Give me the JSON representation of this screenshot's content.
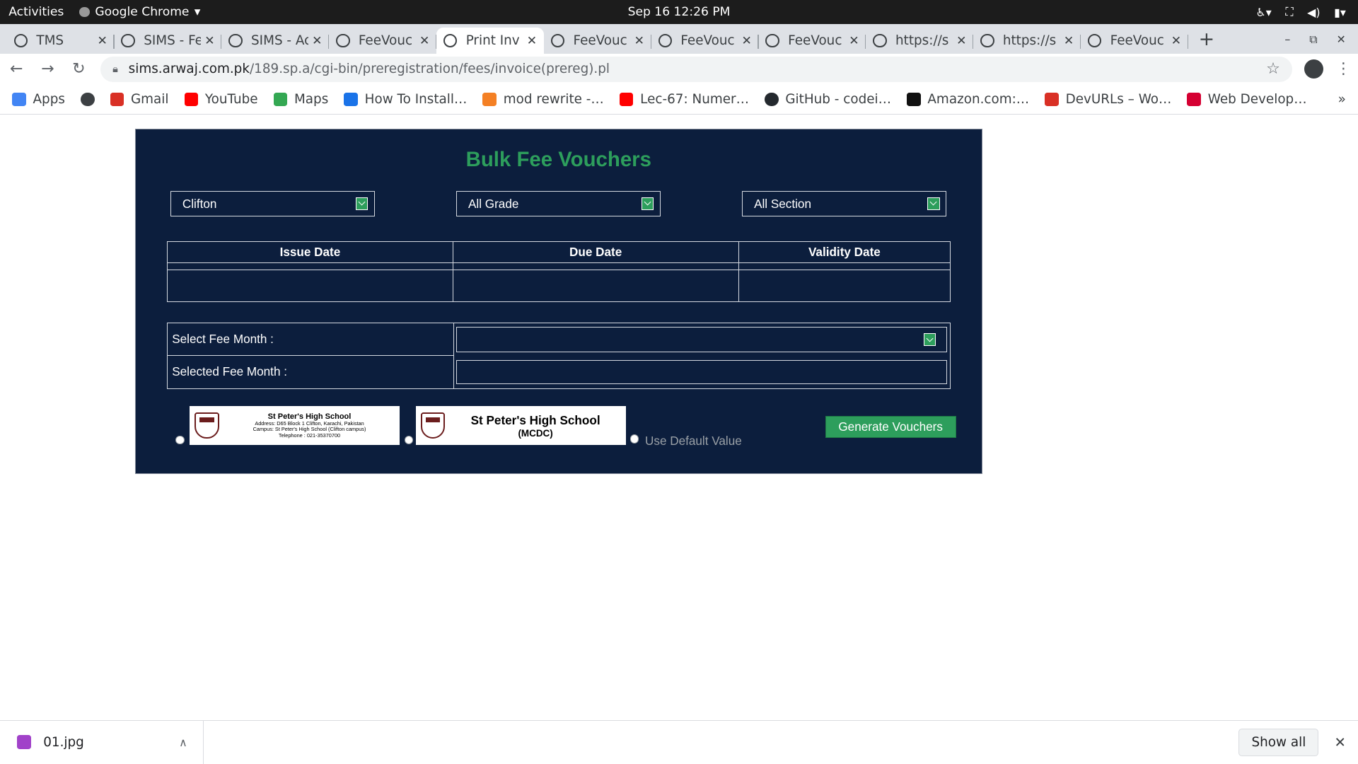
{
  "system": {
    "activities": "Activities",
    "app_name": "Google Chrome",
    "clock": "Sep 16  12:26 PM"
  },
  "tabs": [
    {
      "title": "TMS",
      "active": false
    },
    {
      "title": "SIMS - Fe",
      "active": false
    },
    {
      "title": "SIMS - Ac",
      "active": false
    },
    {
      "title": "FeeVouc",
      "active": false
    },
    {
      "title": "Print Inv",
      "active": true
    },
    {
      "title": "FeeVouc",
      "active": false
    },
    {
      "title": "FeeVouc",
      "active": false
    },
    {
      "title": "FeeVouc",
      "active": false
    },
    {
      "title": "https://s",
      "active": false
    },
    {
      "title": "https://s",
      "active": false
    },
    {
      "title": "FeeVouc",
      "active": false
    }
  ],
  "address": {
    "host": "sims.arwaj.com.pk",
    "path": "/189.sp.a/cgi-bin/preregistration/fees/invoice(prereg).pl"
  },
  "bookmarks": [
    {
      "label": "Apps",
      "icon": "apps-grid-icon",
      "color": "#4285f4"
    },
    {
      "label": "",
      "icon": "globe-icon",
      "color": "#3c4043"
    },
    {
      "label": "Gmail",
      "icon": "gmail-icon",
      "color": "#d93025"
    },
    {
      "label": "YouTube",
      "icon": "youtube-icon",
      "color": "#ff0000"
    },
    {
      "label": "Maps",
      "icon": "maps-pin-icon",
      "color": "#34a853"
    },
    {
      "label": "How To Install…",
      "icon": "refresh-blue-icon",
      "color": "#1a73e8"
    },
    {
      "label": "mod rewrite -…",
      "icon": "stackoverflow-icon",
      "color": "#f48024"
    },
    {
      "label": "Lec-67: Numer…",
      "icon": "youtube-icon",
      "color": "#ff0000"
    },
    {
      "label": "GitHub - codei…",
      "icon": "github-icon",
      "color": "#24292e"
    },
    {
      "label": "Amazon.com:…",
      "icon": "amazon-icon",
      "color": "#111111"
    },
    {
      "label": "DevURLs – Wo…",
      "icon": "devurls-icon",
      "color": "#d93025"
    },
    {
      "label": "Web Develop…",
      "icon": "web-develop-icon",
      "color": "#d50032"
    }
  ],
  "bookmarks_more": "»",
  "form": {
    "title": "Bulk Fee Vouchers",
    "campus": "Clifton",
    "grade": "All Grade",
    "section": "All Section",
    "date_headers": [
      "Issue Date",
      "Due Date",
      "Validity Date"
    ],
    "select_fee_month_label": "Select Fee Month :",
    "selected_fee_month_label": "Selected Fee Month :",
    "header1": {
      "name": "St Peter's High School",
      "address": "Address: D65 Block 1 Clifton, Karachi, Pakistan",
      "campus": "Campus: St Peter's High School (Clifton campus)",
      "telephone": "Telephone : 021-35370700"
    },
    "header2": {
      "name": "St Peter's High School",
      "sub": "(MCDC)"
    },
    "default_label": "Use Default Value",
    "generate_button": "Generate Vouchers"
  },
  "downloads": {
    "file": "01.jpg",
    "show_all": "Show all"
  },
  "colors": {
    "panel_bg": "#0c1e3d",
    "accent_green": "#2d9e5c"
  }
}
